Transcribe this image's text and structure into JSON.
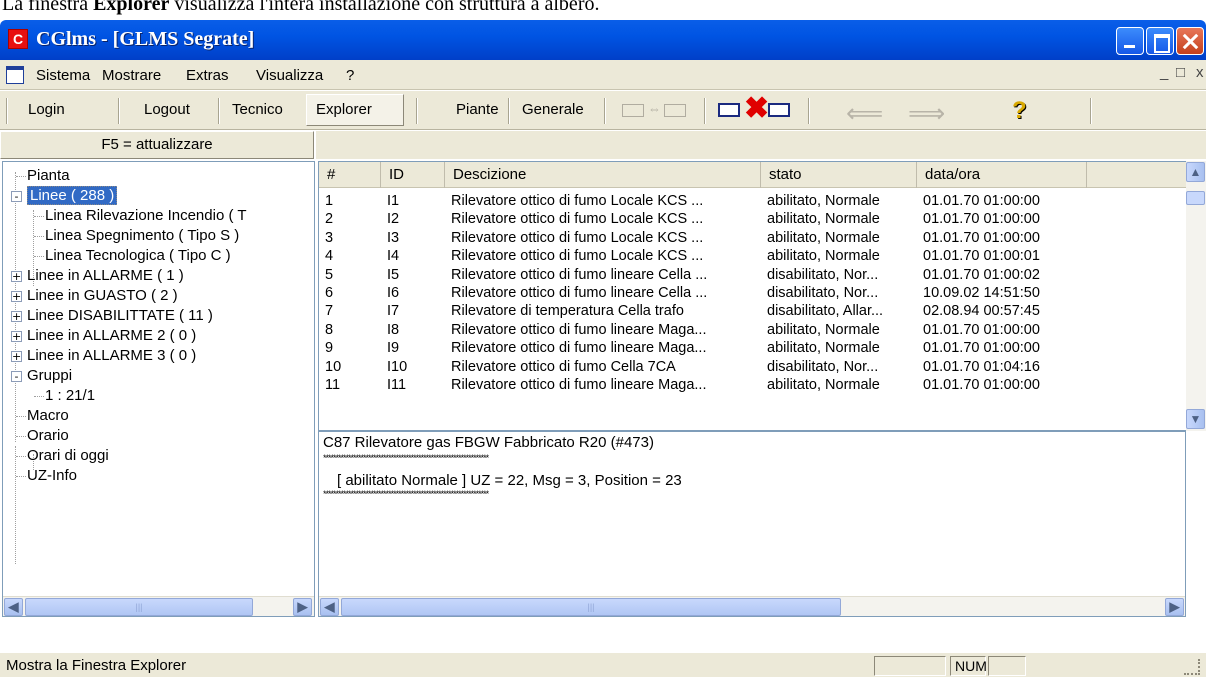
{
  "caption": {
    "prefix": "La finestra ",
    "bold": "Explorer",
    "suffix": " visualizza l'intera installazione con struttura a albero."
  },
  "window": {
    "app_icon_letter": "C",
    "title": "CGlms - [GLMS Segrate]"
  },
  "menu": [
    "Sistema",
    "Mostrare",
    "Extras",
    "Visualizza",
    "?"
  ],
  "menu_right": [
    "_",
    "̅̅",
    "x"
  ],
  "toolbar": {
    "buttons": [
      "Login",
      "Logout",
      "Tecnico",
      "Explorer",
      "Piante",
      "Generale"
    ],
    "icons": [
      "connect-icon",
      "disconnect-icon",
      "back-arrow-icon",
      "forward-arrow-icon",
      "help-icon"
    ]
  },
  "refresh_button": "F5 = attualizzare",
  "tree": {
    "items": [
      {
        "label": "Pianta",
        "level": 0,
        "expander": ""
      },
      {
        "label": "Linee ( 288 )",
        "level": 0,
        "expander": "-",
        "selected": true
      },
      {
        "label": "Linea Rilevazione Incendio ( T",
        "level": 1,
        "expander": ""
      },
      {
        "label": "Linea Spegnimento ( Tipo S )",
        "level": 1,
        "expander": ""
      },
      {
        "label": "Linea Tecnologica ( Tipo C )",
        "level": 1,
        "expander": ""
      },
      {
        "label": "Linee in ALLARME ( 1 )",
        "level": 0,
        "expander": "+"
      },
      {
        "label": "Linee in GUASTO ( 2 )",
        "level": 0,
        "expander": "+"
      },
      {
        "label": "Linee DISABILITTATE ( 11 )",
        "level": 0,
        "expander": "+"
      },
      {
        "label": "Linee in ALLARME 2 ( 0 )",
        "level": 0,
        "expander": "+"
      },
      {
        "label": "Linee in ALLARME 3 ( 0 )",
        "level": 0,
        "expander": "+"
      },
      {
        "label": "Gruppi",
        "level": 0,
        "expander": "-"
      },
      {
        "label": "1 : 21/1",
        "level": 1,
        "expander": ""
      },
      {
        "label": "Macro",
        "level": 0,
        "expander": ""
      },
      {
        "label": "Orario",
        "level": 0,
        "expander": ""
      },
      {
        "label": "Orari di oggi",
        "level": 0,
        "expander": ""
      },
      {
        "label": "UZ-Info",
        "level": 0,
        "expander": ""
      }
    ]
  },
  "table": {
    "columns": [
      "#",
      "ID",
      "Descizione",
      "stato",
      "data/ora",
      ""
    ],
    "rows": [
      [
        "1",
        "I1",
        "Rilevatore ottico di fumo Locale KCS ...",
        "abilitato, Normale",
        "01.01.70 01:00:00"
      ],
      [
        "2",
        "I2",
        "Rilevatore ottico di fumo Locale KCS ...",
        "abilitato, Normale",
        "01.01.70 01:00:00"
      ],
      [
        "3",
        "I3",
        "Rilevatore ottico di fumo Locale KCS ...",
        "abilitato, Normale",
        "01.01.70 01:00:00"
      ],
      [
        "4",
        "I4",
        "Rilevatore ottico di fumo Locale KCS ...",
        "abilitato, Normale",
        "01.01.70 01:00:01"
      ],
      [
        "5",
        "I5",
        "Rilevatore ottico di fumo lineare Cella ...",
        "disabilitato, Nor...",
        "01.01.70 01:00:02"
      ],
      [
        "6",
        "I6",
        "Rilevatore ottico di fumo lineare Cella ...",
        "disabilitato, Nor...",
        "10.09.02 14:51:50"
      ],
      [
        "7",
        "I7",
        "Rilevatore di temperatura Cella trafo",
        "disabilitato, Allar...",
        "02.08.94 00:57:45"
      ],
      [
        "8",
        "I8",
        "Rilevatore ottico di fumo lineare Maga...",
        "abilitato, Normale",
        "01.01.70 01:00:00"
      ],
      [
        "9",
        "I9",
        "Rilevatore ottico di fumo lineare Maga...",
        "abilitato, Normale",
        "01.01.70 01:00:00"
      ],
      [
        "10",
        "I10",
        "Rilevatore ottico di fumo Cella 7CA",
        "disabilitato, Nor...",
        "01.01.70 01:04:16"
      ],
      [
        "11",
        "I11",
        "Rilevatore ottico di fumo lineare Maga...",
        "abilitato, Normale",
        "01.01.70 01:00:00"
      ]
    ]
  },
  "detail": {
    "heading": "C87  Rilevatore gas FBGW Fabbricato R20  (#473)",
    "stars": "******************************************************************",
    "status_line": "[  abilitato  Normale  ]     UZ = 22,  Msg = 3,  Position = 23"
  },
  "statusbar": {
    "text": "Mostra la Finestra Explorer",
    "num": "NUM"
  },
  "colors": {
    "titlebar": "#0054e3",
    "selection": "#316ac5",
    "chrome": "#ece9d8",
    "disconnect_x": "#e00000"
  }
}
